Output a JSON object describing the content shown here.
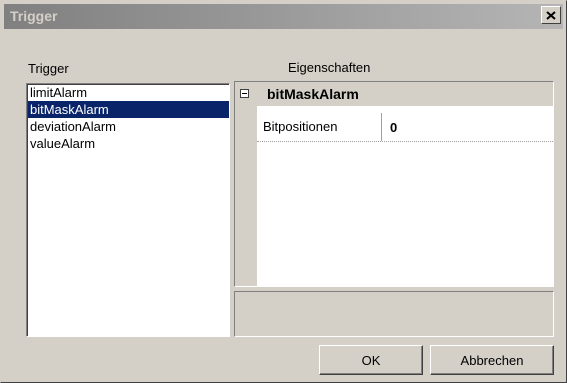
{
  "window": {
    "title": "Trigger",
    "close_icon": "close-icon"
  },
  "labels": {
    "trigger": "Trigger",
    "properties": "Eigenschaften"
  },
  "trigger_list": {
    "items": [
      "limitAlarm",
      "bitMaskAlarm",
      "deviationAlarm",
      "valueAlarm"
    ],
    "selected": "bitMaskAlarm"
  },
  "property_grid": {
    "category": "bitMaskAlarm",
    "rows": [
      {
        "name": "Bitpositionen",
        "value": "0"
      }
    ]
  },
  "buttons": {
    "ok": "OK",
    "cancel": "Abbrechen"
  },
  "colors": {
    "selection": "#0a246a",
    "face": "#d4d0c8",
    "title_start": "#808080",
    "title_end": "#b5b5b5"
  }
}
